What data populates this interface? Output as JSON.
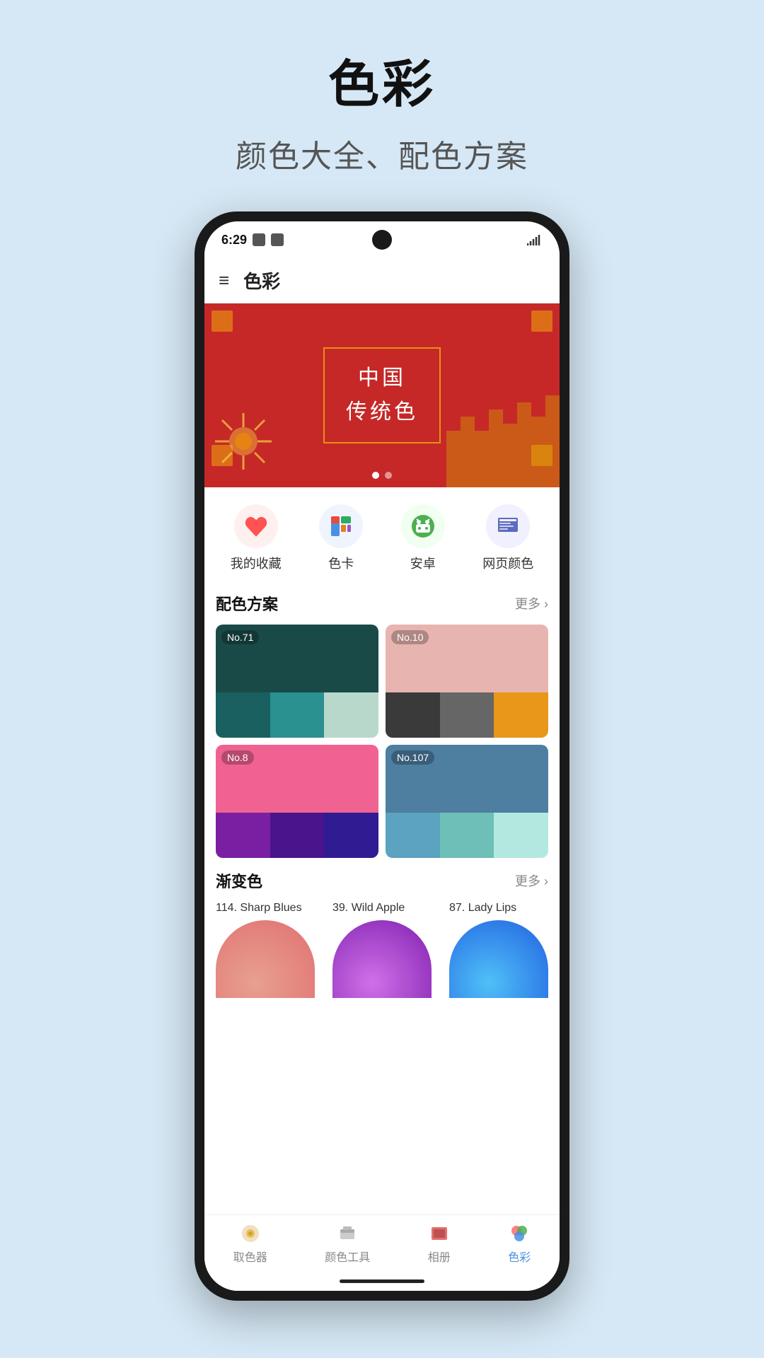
{
  "page": {
    "title": "色彩",
    "subtitle": "颜色大全、配色方案"
  },
  "status_bar": {
    "time": "6:29",
    "signal": "▎"
  },
  "app_bar": {
    "title": "色彩",
    "menu_label": "≡"
  },
  "banner": {
    "line1": "中国",
    "line2": "传统色"
  },
  "quick_icons": [
    {
      "id": "favorites",
      "label": "我的收藏",
      "icon": "⭐",
      "color": "#ff6b6b"
    },
    {
      "id": "colorcard",
      "label": "色卡",
      "icon": "🎨",
      "color": "#4a90e2"
    },
    {
      "id": "android",
      "label": "安卓",
      "icon": "🤖",
      "color": "#4caf50"
    },
    {
      "id": "webcolor",
      "label": "网页颜色",
      "icon": "🌐",
      "color": "#5c6bc0"
    }
  ],
  "sections": {
    "palette": {
      "title": "配色方案",
      "more": "更多"
    },
    "gradient": {
      "title": "渐变色",
      "more": "更多"
    }
  },
  "palettes": [
    {
      "num": "No.71",
      "top": "#1a4a47",
      "swatches": [
        "#1a6060",
        "#2a9090",
        "#b8d8cc"
      ]
    },
    {
      "num": "No.10",
      "top": "#e8b4b0",
      "swatches": [
        "#3a3a3a",
        "#666666",
        "#e8971a"
      ]
    },
    {
      "num": "No.8",
      "top": "#f06292",
      "swatches": [
        "#7b1fa2",
        "#4a148c",
        "#311b92"
      ]
    },
    {
      "num": "No.107",
      "top": "#4e7ea0",
      "swatches": [
        "#5ba3c0",
        "#6dbfb8",
        "#b2e8e0"
      ]
    }
  ],
  "gradients": [
    {
      "label": "114. Sharp Blues",
      "from": "#e8a090",
      "to": "#e07070"
    },
    {
      "label": "39. Wild Apple",
      "from": "#c070e0",
      "to": "#9030c0"
    },
    {
      "label": "87. Lady Lips",
      "from": "#4ab0f0",
      "to": "#2070e0"
    }
  ],
  "bottom_nav": [
    {
      "label": "取色器",
      "icon": "🎨",
      "active": false
    },
    {
      "label": "颜色工具",
      "icon": "🖌️",
      "active": false
    },
    {
      "label": "相册",
      "icon": "🖼️",
      "active": false
    },
    {
      "label": "色彩",
      "icon": "🎭",
      "active": true
    }
  ]
}
